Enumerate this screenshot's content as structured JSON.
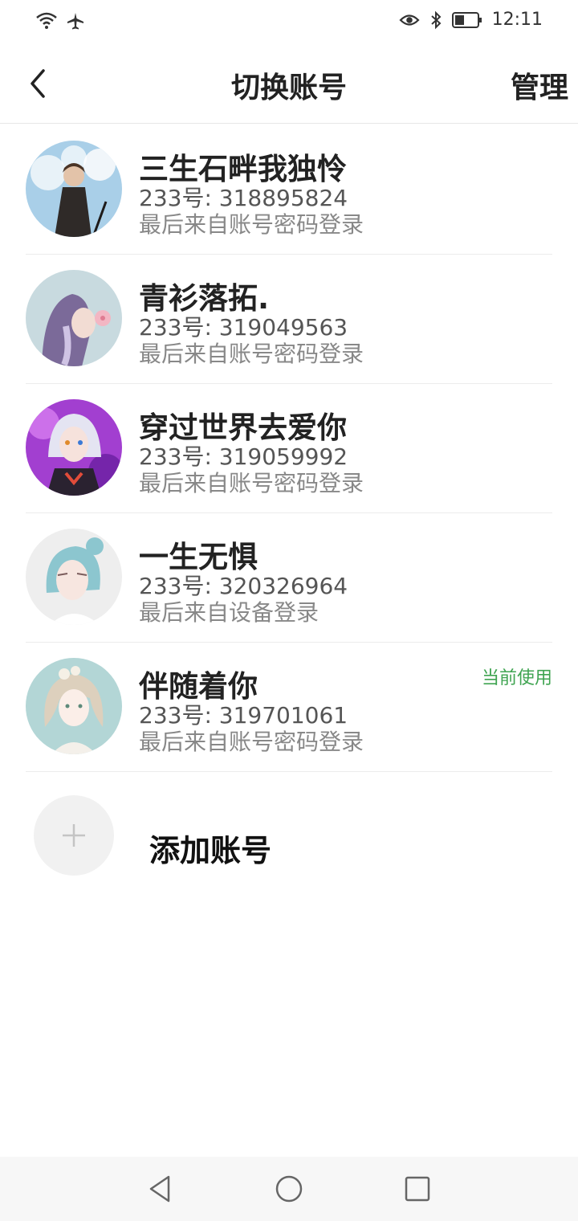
{
  "status_bar": {
    "time": "12:11",
    "icons": [
      "wifi-icon",
      "airplane-icon",
      "eye-icon",
      "bluetooth-icon",
      "battery-icon"
    ]
  },
  "header": {
    "title": "切换账号",
    "manage_label": "管理"
  },
  "accounts": [
    {
      "name": "三生石畔我独怜",
      "id_text": "233号: 318895824",
      "login_text": "最后来自账号密码登录",
      "current": ""
    },
    {
      "name": "青衫落拓.",
      "id_text": "233号: 319049563",
      "login_text": "最后来自账号密码登录",
      "current": ""
    },
    {
      "name": "穿过世界去爱你",
      "id_text": "233号: 319059992",
      "login_text": "最后来自账号密码登录",
      "current": ""
    },
    {
      "name": "一生无惧",
      "id_text": "233号: 320326964",
      "login_text": "最后来自设备登录",
      "current": ""
    },
    {
      "name": "伴随着你",
      "id_text": "233号: 319701061",
      "login_text": "最后来自账号密码登录",
      "current": "当前使用"
    }
  ],
  "add_account": {
    "label": "添加账号"
  },
  "colors": {
    "accent_green": "#3fa451",
    "text_dark": "#222222",
    "text_gray": "#888888"
  }
}
